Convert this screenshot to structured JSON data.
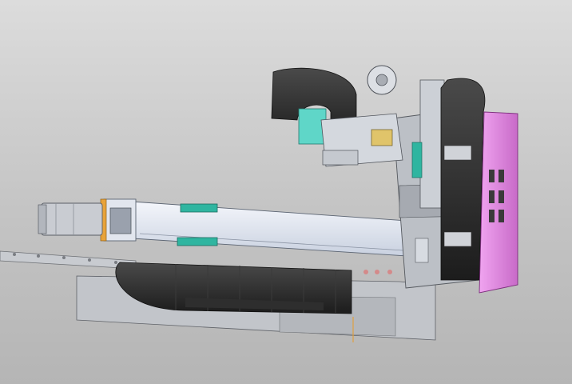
{
  "viewport": {
    "background_top": "#dcdcdc",
    "background_bottom": "#b5b5b5"
  },
  "model": {
    "colors": {
      "cable_chain": "#2a2a2a",
      "bracket_magenta": "#e58ae5",
      "linear_guide_teal": "#2fb5a0",
      "actuator_body": "#dfe6f3",
      "frame_gray": "#bcc0c6",
      "servo_motor": "#c9ccd2",
      "coupling_orange": "#e8a33a"
    },
    "icons": [
      "cable-chain-icon",
      "linear-actuator-icon",
      "servo-motor-icon",
      "magenta-bracket-icon",
      "gripper-icon",
      "base-rail-icon"
    ]
  }
}
